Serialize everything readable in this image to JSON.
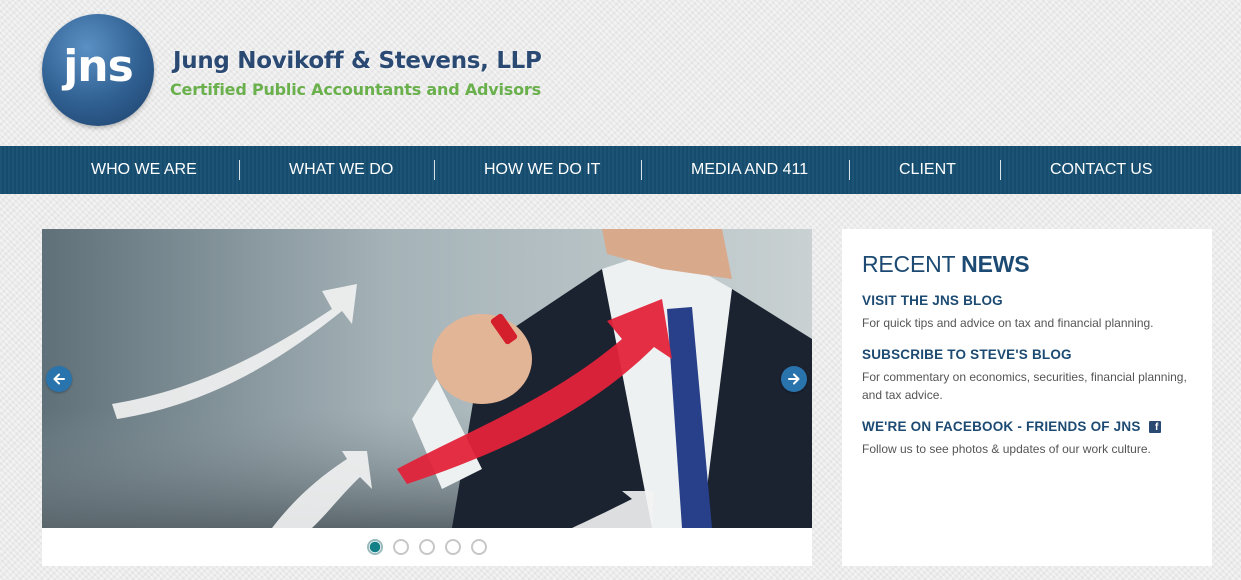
{
  "logo": {
    "initials": "jns"
  },
  "firm": {
    "name": "Jung Novikoff & Stevens, LLP",
    "tagline": "Certified Public Accountants and Advisors"
  },
  "nav": {
    "items": [
      {
        "label": "WHO WE ARE"
      },
      {
        "label": "WHAT WE DO"
      },
      {
        "label": "HOW WE DO IT"
      },
      {
        "label": "MEDIA AND 411"
      },
      {
        "label": "CLIENT"
      },
      {
        "label": "CONTACT US"
      }
    ]
  },
  "slider": {
    "total_slides": 5,
    "active_slide": 1,
    "prev_icon": "arrow-left-icon",
    "next_icon": "arrow-right-icon"
  },
  "news": {
    "heading_light": "RECENT",
    "heading_bold": "NEWS",
    "items": [
      {
        "title": "VISIT THE JNS BLOG",
        "desc": "For quick tips and advice on tax and financial planning."
      },
      {
        "title": "SUBSCRIBE TO STEVE'S BLOG",
        "desc": "For commentary on economics, securities, financial planning, and tax advice."
      },
      {
        "title": "WE'RE ON FACEBOOK - FRIENDS OF JNS",
        "desc": "Follow us to see photos & updates of our work culture.",
        "icon": "facebook-icon"
      }
    ]
  },
  "colors": {
    "nav_bg": "#164e72",
    "brand_blue": "#1c4a72",
    "tagline_green": "#6ab04c",
    "arrow_button": "#2a74ad"
  }
}
